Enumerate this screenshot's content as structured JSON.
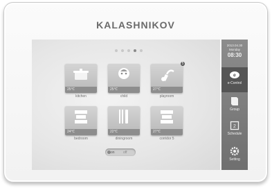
{
  "device": {
    "brand": "KALASHNIKOV"
  },
  "pager": {
    "count": 5,
    "active_index": 3
  },
  "tiles": [
    {
      "name": "kitchen",
      "label": "kitchen",
      "status": "25℃",
      "icon": "cooking-pot-icon"
    },
    {
      "name": "child",
      "label": "child",
      "status": "25℃",
      "icon": "child-face-icon"
    },
    {
      "name": "playroom",
      "label": "playroom",
      "status": "27℃",
      "icon": "gamepad-icon",
      "badge": "5"
    },
    {
      "name": "bedroom",
      "label": "bedroom",
      "status": "24℃",
      "icon": "stack-icon"
    },
    {
      "name": "diningroom",
      "label": "diningroom",
      "status": "22℃",
      "icon": "fork-knife-icon"
    },
    {
      "name": "corridor",
      "label": "corridor 5",
      "status": "27℃",
      "icon": "stack-icon"
    }
  ],
  "toggle": {
    "left_label": "on",
    "right_label": "off"
  },
  "sidebar": {
    "date": "2013.04.30",
    "day": "Monday",
    "time": "08:30",
    "items": [
      {
        "label": "e-Control",
        "icon": "e-control-icon",
        "active": true
      },
      {
        "label": "Group",
        "icon": "book-icon",
        "active": false
      },
      {
        "label": "Schedule",
        "icon": "calendar-icon",
        "active": false
      },
      {
        "label": "Setting",
        "icon": "gear-icon",
        "active": false
      }
    ]
  },
  "colors": {
    "sidebar": "#7a7a7a",
    "active_nav": "#555555",
    "tile": "#c4c4c4"
  }
}
